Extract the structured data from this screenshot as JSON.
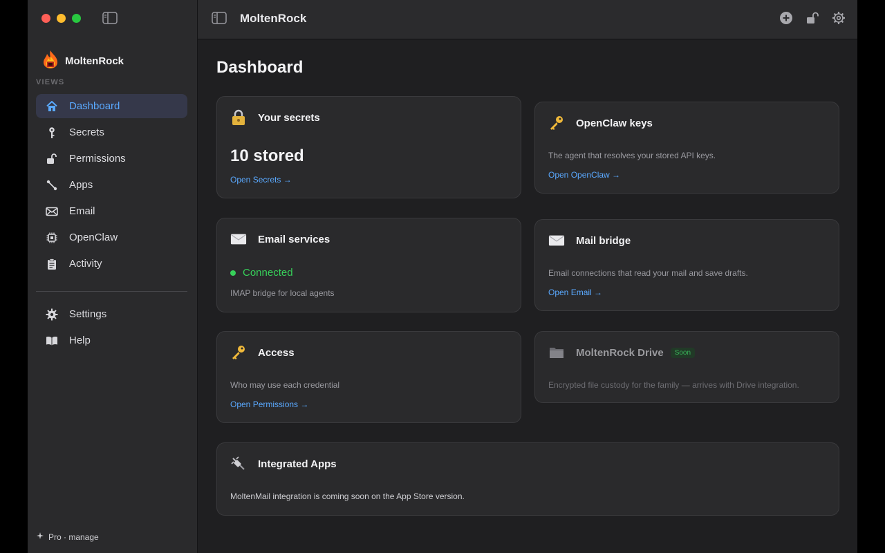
{
  "app": {
    "title": "MoltenRock"
  },
  "sidebar": {
    "brand": "MoltenRock",
    "section_label": "VIEWS",
    "items": [
      {
        "label": "Dashboard",
        "icon": "house-icon",
        "active": true
      },
      {
        "label": "Secrets",
        "icon": "key-icon"
      },
      {
        "label": "Permissions",
        "icon": "lock-open-icon"
      },
      {
        "label": "Apps",
        "icon": "connector-icon"
      },
      {
        "label": "Email",
        "icon": "envelope-icon"
      },
      {
        "label": "OpenClaw",
        "icon": "cpu-icon"
      },
      {
        "label": "Activity",
        "icon": "clipboard-icon"
      }
    ],
    "bottom_items": [
      {
        "label": "Settings",
        "icon": "gear-icon"
      },
      {
        "label": "Help",
        "icon": "book-icon"
      }
    ],
    "footer": "Pro · manage"
  },
  "main": {
    "title": "Dashboard",
    "cards": {
      "secrets": {
        "title": "Your secrets",
        "value": "10 stored",
        "link": "Open Secrets →"
      },
      "openclaw": {
        "title": "OpenClaw keys",
        "desc": "The agent that resolves your stored API keys.",
        "link": "Open OpenClaw →"
      },
      "email_services": {
        "title": "Email services",
        "status": "Connected",
        "desc": "IMAP bridge for local agents"
      },
      "mail_bridge": {
        "title": "Mail bridge",
        "desc": "Email connections that read your mail and save drafts.",
        "link": "Open Email →"
      },
      "access": {
        "title": "Access",
        "desc": "Who may use each credential",
        "link": "Open Permissions →"
      },
      "drive": {
        "title": "MoltenRock Drive",
        "badge": "Soon",
        "desc": "Encrypted file custody for the family — arrives with Drive integration."
      },
      "integrated": {
        "title": "Integrated Apps",
        "desc": "MoltenMail integration is coming soon on the App Store version."
      }
    }
  },
  "colors": {
    "accent": "#5aa9ff",
    "success": "#37d05a",
    "active_bg": "#35384a"
  }
}
